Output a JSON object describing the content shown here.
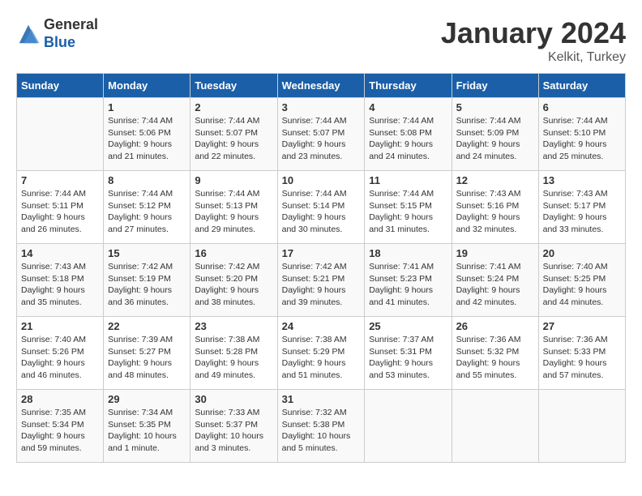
{
  "logo": {
    "general": "General",
    "blue": "Blue"
  },
  "title": "January 2024",
  "location": "Kelkit, Turkey",
  "days_of_week": [
    "Sunday",
    "Monday",
    "Tuesday",
    "Wednesday",
    "Thursday",
    "Friday",
    "Saturday"
  ],
  "weeks": [
    [
      {
        "day": "",
        "info": ""
      },
      {
        "day": "1",
        "info": "Sunrise: 7:44 AM\nSunset: 5:06 PM\nDaylight: 9 hours\nand 21 minutes."
      },
      {
        "day": "2",
        "info": "Sunrise: 7:44 AM\nSunset: 5:07 PM\nDaylight: 9 hours\nand 22 minutes."
      },
      {
        "day": "3",
        "info": "Sunrise: 7:44 AM\nSunset: 5:07 PM\nDaylight: 9 hours\nand 23 minutes."
      },
      {
        "day": "4",
        "info": "Sunrise: 7:44 AM\nSunset: 5:08 PM\nDaylight: 9 hours\nand 24 minutes."
      },
      {
        "day": "5",
        "info": "Sunrise: 7:44 AM\nSunset: 5:09 PM\nDaylight: 9 hours\nand 24 minutes."
      },
      {
        "day": "6",
        "info": "Sunrise: 7:44 AM\nSunset: 5:10 PM\nDaylight: 9 hours\nand 25 minutes."
      }
    ],
    [
      {
        "day": "7",
        "info": "Sunrise: 7:44 AM\nSunset: 5:11 PM\nDaylight: 9 hours\nand 26 minutes."
      },
      {
        "day": "8",
        "info": "Sunrise: 7:44 AM\nSunset: 5:12 PM\nDaylight: 9 hours\nand 27 minutes."
      },
      {
        "day": "9",
        "info": "Sunrise: 7:44 AM\nSunset: 5:13 PM\nDaylight: 9 hours\nand 29 minutes."
      },
      {
        "day": "10",
        "info": "Sunrise: 7:44 AM\nSunset: 5:14 PM\nDaylight: 9 hours\nand 30 minutes."
      },
      {
        "day": "11",
        "info": "Sunrise: 7:44 AM\nSunset: 5:15 PM\nDaylight: 9 hours\nand 31 minutes."
      },
      {
        "day": "12",
        "info": "Sunrise: 7:43 AM\nSunset: 5:16 PM\nDaylight: 9 hours\nand 32 minutes."
      },
      {
        "day": "13",
        "info": "Sunrise: 7:43 AM\nSunset: 5:17 PM\nDaylight: 9 hours\nand 33 minutes."
      }
    ],
    [
      {
        "day": "14",
        "info": "Sunrise: 7:43 AM\nSunset: 5:18 PM\nDaylight: 9 hours\nand 35 minutes."
      },
      {
        "day": "15",
        "info": "Sunrise: 7:42 AM\nSunset: 5:19 PM\nDaylight: 9 hours\nand 36 minutes."
      },
      {
        "day": "16",
        "info": "Sunrise: 7:42 AM\nSunset: 5:20 PM\nDaylight: 9 hours\nand 38 minutes."
      },
      {
        "day": "17",
        "info": "Sunrise: 7:42 AM\nSunset: 5:21 PM\nDaylight: 9 hours\nand 39 minutes."
      },
      {
        "day": "18",
        "info": "Sunrise: 7:41 AM\nSunset: 5:23 PM\nDaylight: 9 hours\nand 41 minutes."
      },
      {
        "day": "19",
        "info": "Sunrise: 7:41 AM\nSunset: 5:24 PM\nDaylight: 9 hours\nand 42 minutes."
      },
      {
        "day": "20",
        "info": "Sunrise: 7:40 AM\nSunset: 5:25 PM\nDaylight: 9 hours\nand 44 minutes."
      }
    ],
    [
      {
        "day": "21",
        "info": "Sunrise: 7:40 AM\nSunset: 5:26 PM\nDaylight: 9 hours\nand 46 minutes."
      },
      {
        "day": "22",
        "info": "Sunrise: 7:39 AM\nSunset: 5:27 PM\nDaylight: 9 hours\nand 48 minutes."
      },
      {
        "day": "23",
        "info": "Sunrise: 7:38 AM\nSunset: 5:28 PM\nDaylight: 9 hours\nand 49 minutes."
      },
      {
        "day": "24",
        "info": "Sunrise: 7:38 AM\nSunset: 5:29 PM\nDaylight: 9 hours\nand 51 minutes."
      },
      {
        "day": "25",
        "info": "Sunrise: 7:37 AM\nSunset: 5:31 PM\nDaylight: 9 hours\nand 53 minutes."
      },
      {
        "day": "26",
        "info": "Sunrise: 7:36 AM\nSunset: 5:32 PM\nDaylight: 9 hours\nand 55 minutes."
      },
      {
        "day": "27",
        "info": "Sunrise: 7:36 AM\nSunset: 5:33 PM\nDaylight: 9 hours\nand 57 minutes."
      }
    ],
    [
      {
        "day": "28",
        "info": "Sunrise: 7:35 AM\nSunset: 5:34 PM\nDaylight: 9 hours\nand 59 minutes."
      },
      {
        "day": "29",
        "info": "Sunrise: 7:34 AM\nSunset: 5:35 PM\nDaylight: 10 hours\nand 1 minute."
      },
      {
        "day": "30",
        "info": "Sunrise: 7:33 AM\nSunset: 5:37 PM\nDaylight: 10 hours\nand 3 minutes."
      },
      {
        "day": "31",
        "info": "Sunrise: 7:32 AM\nSunset: 5:38 PM\nDaylight: 10 hours\nand 5 minutes."
      },
      {
        "day": "",
        "info": ""
      },
      {
        "day": "",
        "info": ""
      },
      {
        "day": "",
        "info": ""
      }
    ]
  ]
}
